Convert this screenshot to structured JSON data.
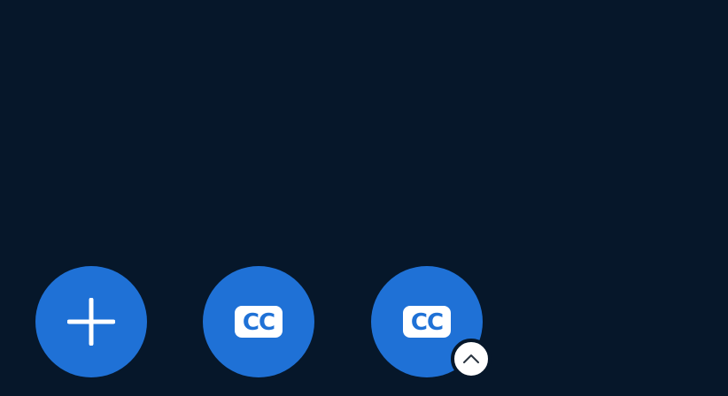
{
  "buttons": {
    "add": {
      "icon": "plus-icon"
    },
    "captions_1": {
      "label": "CC",
      "icon": "closed-captions-icon"
    },
    "captions_2": {
      "label": "CC",
      "icon": "closed-captions-icon"
    }
  },
  "badge": {
    "icon": "chevron-up-icon"
  },
  "colors": {
    "background": "#06172a",
    "accent": "#1f71d6",
    "icon_fg": "#ffffff"
  }
}
